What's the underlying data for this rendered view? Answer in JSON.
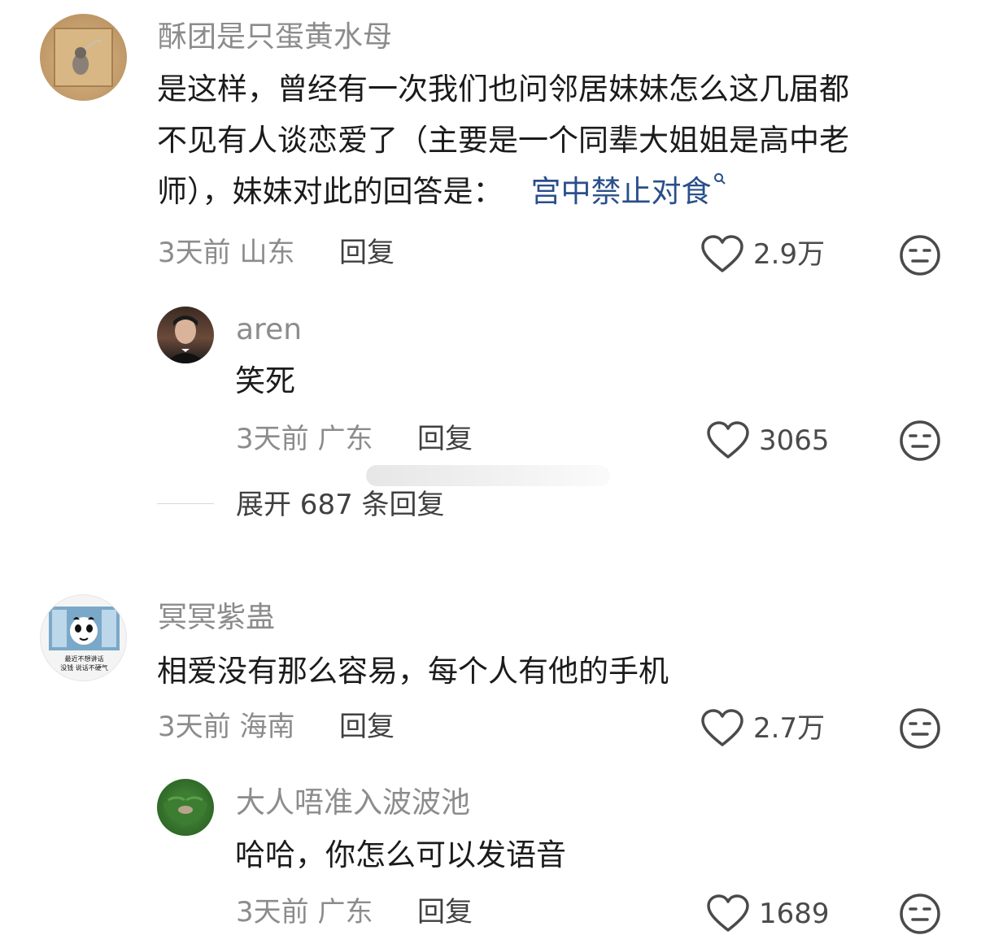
{
  "comments": [
    {
      "username": "酥团是只蛋黄水母",
      "lines": [
        "是这样，曾经有一次我们也问邻居妹妹怎么这几届都",
        "不见有人谈恋爱了（主要是一个同辈大姐姐是高中老",
        "师），妹妹对此的回答是："
      ],
      "link": "宫中禁止对食",
      "link_icon": "search-icon",
      "time": "3天前",
      "location": "山东",
      "reply_label": "回复",
      "likes": "2.9万",
      "reply": {
        "username": "aren",
        "text": "笑死",
        "time": "3天前",
        "location": "广东",
        "reply_label": "回复",
        "likes": "3065"
      },
      "expand_label": "展开 687 条回复"
    },
    {
      "username": "冥冥紫蛊",
      "avatar_text": [
        "最近不想讲话",
        "没钱 说话不硬气"
      ],
      "text": "相爱没有那么容易，每个人有他的手机",
      "time": "3天前",
      "location": "海南",
      "reply_label": "回复",
      "likes": "2.7万",
      "reply": {
        "username": "大人唔准入波波池",
        "text": "哈哈，你怎么可以发语音",
        "time": "3天前",
        "location": "广东",
        "reply_label": "回复",
        "likes": "1689"
      }
    }
  ],
  "icons": {
    "like": "heart-outline-icon",
    "dislike": "neutral-face-icon"
  },
  "colors": {
    "text": "#1b1b1b",
    "secondary": "#8c8c8c",
    "link": "#2a4f8a",
    "background": "#ffffff"
  }
}
